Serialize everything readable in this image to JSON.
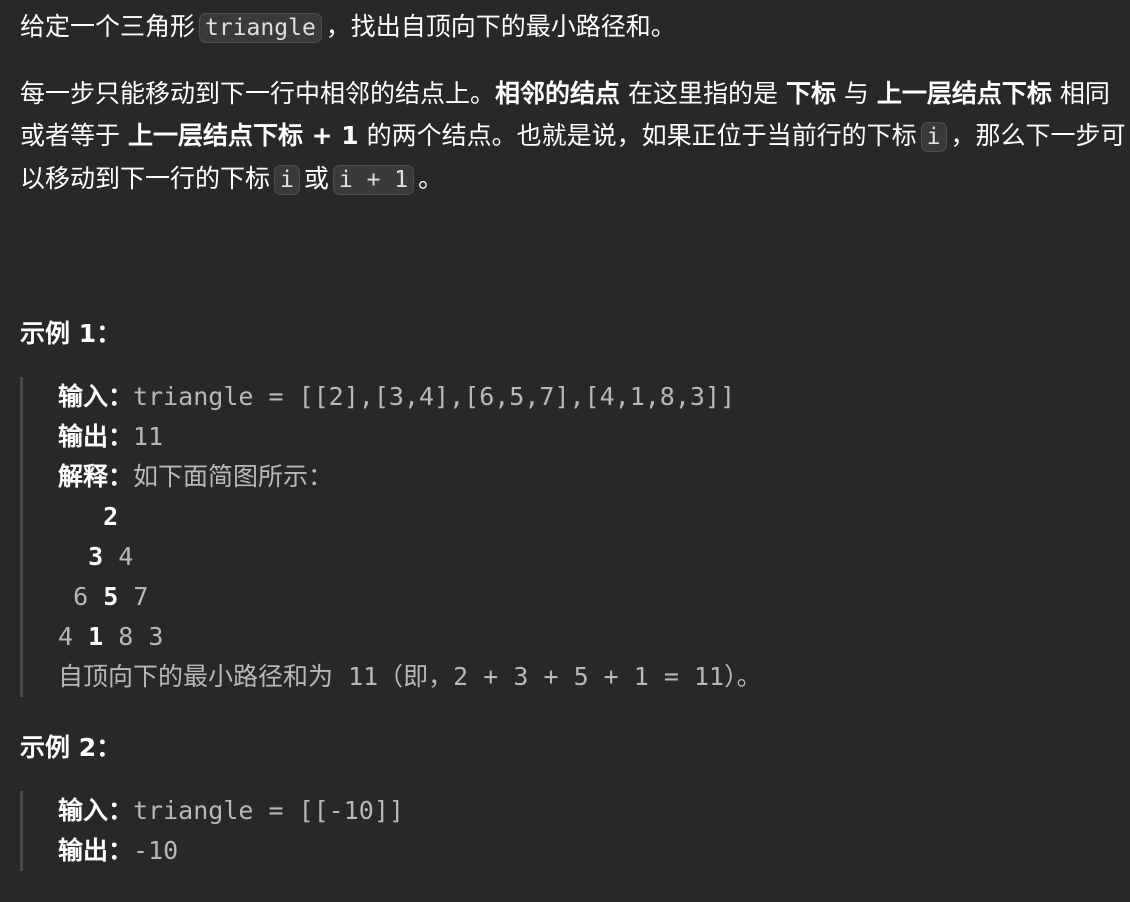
{
  "description": {
    "p1": {
      "t1": "给定一个三角形",
      "code": "triangle",
      "t2": "，找出自顶向下的最小路径和。"
    },
    "p2": {
      "t1": "每一步只能移动到下一行中相邻的结点上。",
      "b1": "相邻的结点",
      "t2": " 在这里指的是 ",
      "b2": "下标",
      "t3": " 与 ",
      "b3": "上一层结点下标",
      "t4": " 相同或者等于 ",
      "b4": "上一层结点下标 + 1",
      "t5": " 的两个结点。也就是说，如果正位于当前行的下标",
      "code1": "i",
      "t6": "，那么下一步可以移动到下一行的下标",
      "code2": "i",
      "t7": "或",
      "code3": "i + 1",
      "t8": "。"
    }
  },
  "example1": {
    "title": "示例 1：",
    "input_label": "输入：",
    "input_value": "triangle = [[2],[3,4],[6,5,7],[4,1,8,3]]",
    "output_label": "输出：",
    "output_value": "11",
    "explain_label": "解释：",
    "explain_value": "如下面简图所示：",
    "tri_row1_bold": "2",
    "tri_row2_bold": "3",
    "tri_row2_rest": "4",
    "tri_row3_a": "6",
    "tri_row3_bold": "5",
    "tri_row3_b": "7",
    "tri_row4_a": "4",
    "tri_row4_bold": "1",
    "tri_row4_rest": "8 3",
    "conclusion_cjk": "自顶向下的最小路径和为",
    "conclusion_value": " 11（即，2 + 3 + 5 + 1 = 11）。"
  },
  "example2": {
    "title": "示例 2：",
    "input_label": "输入：",
    "input_value": "triangle = [[-10]]",
    "output_label": "输出：",
    "output_value": "-10"
  }
}
